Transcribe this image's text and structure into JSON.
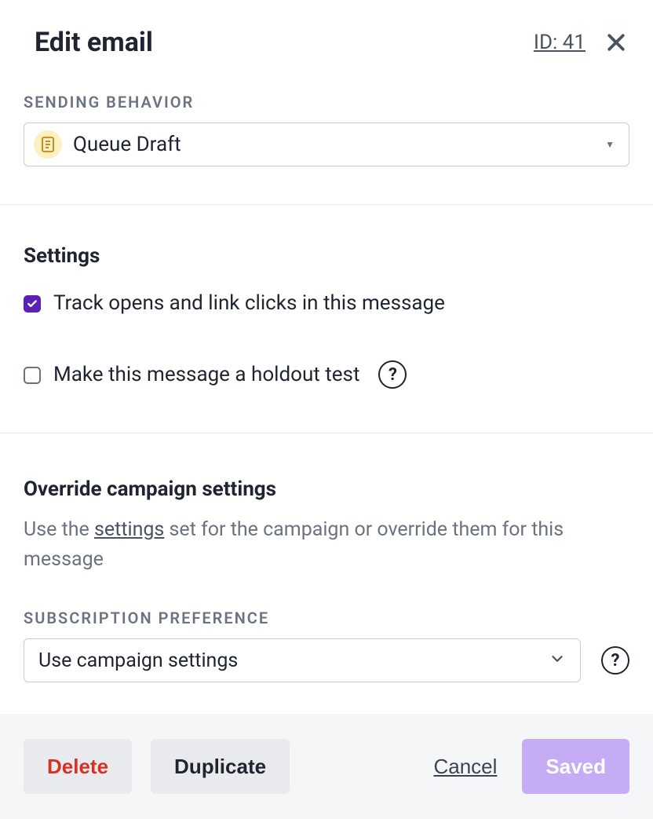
{
  "header": {
    "title": "Edit email",
    "id_label": "ID: 41"
  },
  "sending": {
    "label": "SENDING BEHAVIOR",
    "selected": "Queue Draft"
  },
  "settings": {
    "title": "Settings",
    "track_label": "Track opens and link clicks in this message",
    "holdout_label": "Make this message a holdout test"
  },
  "override": {
    "title": "Override campaign settings",
    "desc_pre": "Use the ",
    "desc_link": "settings",
    "desc_post": " set for the campaign or override them for this message",
    "pref_label": "SUBSCRIPTION PREFERENCE",
    "pref_selected": "Use campaign settings"
  },
  "footer": {
    "delete": "Delete",
    "duplicate": "Duplicate",
    "cancel": "Cancel",
    "saved": "Saved"
  }
}
